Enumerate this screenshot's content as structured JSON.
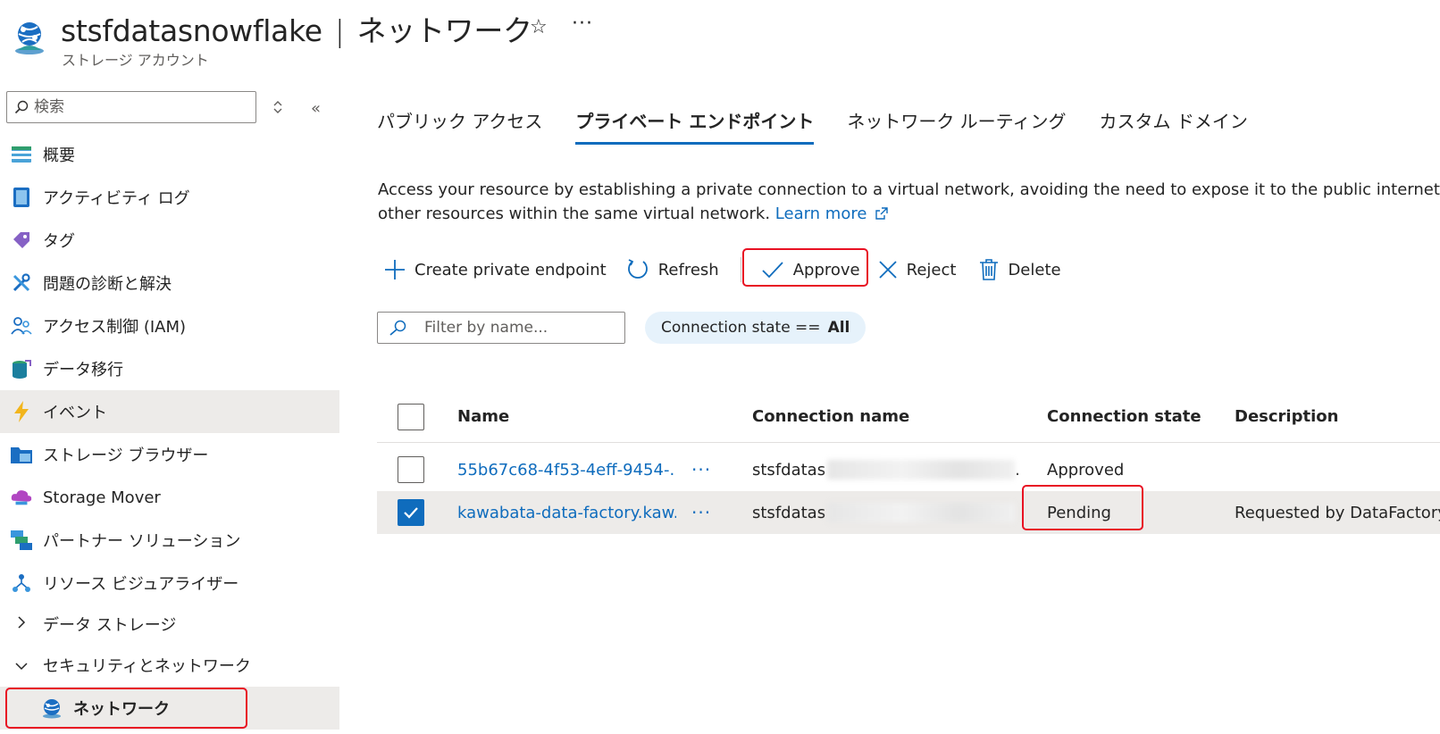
{
  "header": {
    "resource_name": "stsfdatasnowflake",
    "separator": "|",
    "page_name": "ネットワーク",
    "subtitle": "ストレージ アカウント",
    "favorite_glyph": "☆",
    "more_glyph": "···"
  },
  "sidebar": {
    "search_placeholder": "検索",
    "collapse_glyph": "«",
    "items": [
      {
        "label": "概要",
        "icon": "overview-icon"
      },
      {
        "label": "アクティビティ ログ",
        "icon": "activity-log-icon"
      },
      {
        "label": "タグ",
        "icon": "tag-icon"
      },
      {
        "label": "問題の診断と解決",
        "icon": "wrench-icon"
      },
      {
        "label": "アクセス制御 (IAM)",
        "icon": "people-icon"
      },
      {
        "label": "データ移行",
        "icon": "data-migration-icon"
      },
      {
        "label": "イベント",
        "icon": "lightning-icon"
      },
      {
        "label": "ストレージ ブラウザー",
        "icon": "storage-browser-icon"
      },
      {
        "label": "Storage Mover",
        "icon": "storage-mover-icon"
      },
      {
        "label": "パートナー ソリューション",
        "icon": "partner-icon"
      },
      {
        "label": "リソース ビジュアライザー",
        "icon": "resource-visualizer-icon"
      }
    ],
    "groups": [
      {
        "label": "データ ストレージ",
        "chevron": "›"
      },
      {
        "label": "セキュリティとネットワーク",
        "chevron": "⌄"
      }
    ],
    "active_child": "ネットワーク"
  },
  "tabs": [
    {
      "label": "パブリック アクセス"
    },
    {
      "label": "プライベート エンドポイント"
    },
    {
      "label": "ネットワーク ルーティング"
    },
    {
      "label": "カスタム ドメイン"
    }
  ],
  "description": {
    "line1": "Access your resource by establishing a private connection to a virtual network, avoiding the need to expose it to the public internet and en",
    "line2": "other resources within the same virtual network.",
    "learn_more": "Learn more"
  },
  "toolbar": {
    "create": "Create private endpoint",
    "refresh": "Refresh",
    "approve": "Approve",
    "reject": "Reject",
    "delete": "Delete"
  },
  "filter": {
    "placeholder": "Filter by name...",
    "pill_label": "Connection state ==",
    "pill_value": "All"
  },
  "table": {
    "columns": [
      "Name",
      "Connection name",
      "Connection state",
      "Description"
    ],
    "rows": [
      {
        "name": "55b67c68-4f53-4eff-9454-...",
        "connection_name": "stsfdatas",
        "trail": ".",
        "state": "Approved",
        "description": "",
        "selected": false
      },
      {
        "name": "kawabata-data-factory.kaw...",
        "connection_name": "stsfdatas",
        "trail": "",
        "state": "Pending",
        "description": "Requested by DataFactory:",
        "selected": true
      }
    ],
    "row_more_glyph": "···"
  },
  "colors": {
    "accent": "#0f6cbd",
    "highlight_box": "#e81123",
    "selected_row": "#edebe9",
    "pill_bg": "#e6f2fb"
  }
}
